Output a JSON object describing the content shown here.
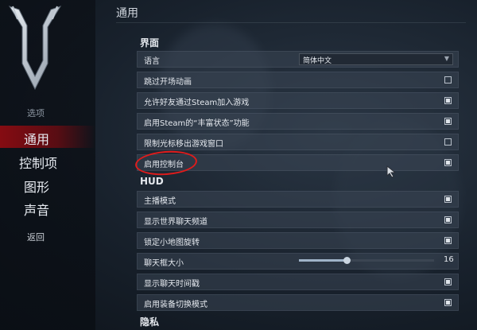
{
  "sidebar": {
    "section_label": "选项",
    "items": [
      {
        "label": "通用",
        "active": true
      },
      {
        "label": "控制项",
        "active": false
      },
      {
        "label": "图形",
        "active": false
      },
      {
        "label": "声音",
        "active": false
      }
    ],
    "back_label": "返回"
  },
  "page": {
    "title": "通用"
  },
  "interface": {
    "title": "界面",
    "language": {
      "label": "语言",
      "value": "简体中文"
    },
    "rows": [
      {
        "label": "跳过开场动画",
        "checked": false
      },
      {
        "label": "允许好友通过Steam加入游戏",
        "checked": true
      },
      {
        "label": "启用Steam的“丰富状态”功能",
        "checked": true
      },
      {
        "label": "限制光标移出游戏窗口",
        "checked": false
      },
      {
        "label": "启用控制台",
        "checked": true
      }
    ]
  },
  "hud": {
    "title": "HUD",
    "rows": [
      {
        "label": "主播模式",
        "checked": true
      },
      {
        "label": "显示世界聊天频道",
        "checked": true
      },
      {
        "label": "锁定小地图旋转",
        "checked": true
      }
    ],
    "chat_size": {
      "label": "聊天框大小",
      "value": "16",
      "fraction": 0.35
    },
    "rows2": [
      {
        "label": "显示聊天时间戳",
        "checked": true
      },
      {
        "label": "启用装备切换模式",
        "checked": true
      }
    ]
  },
  "privacy": {
    "title": "隐私"
  },
  "colors": {
    "accent_red": "#8c0c12",
    "annotation": "#e01b1b"
  }
}
